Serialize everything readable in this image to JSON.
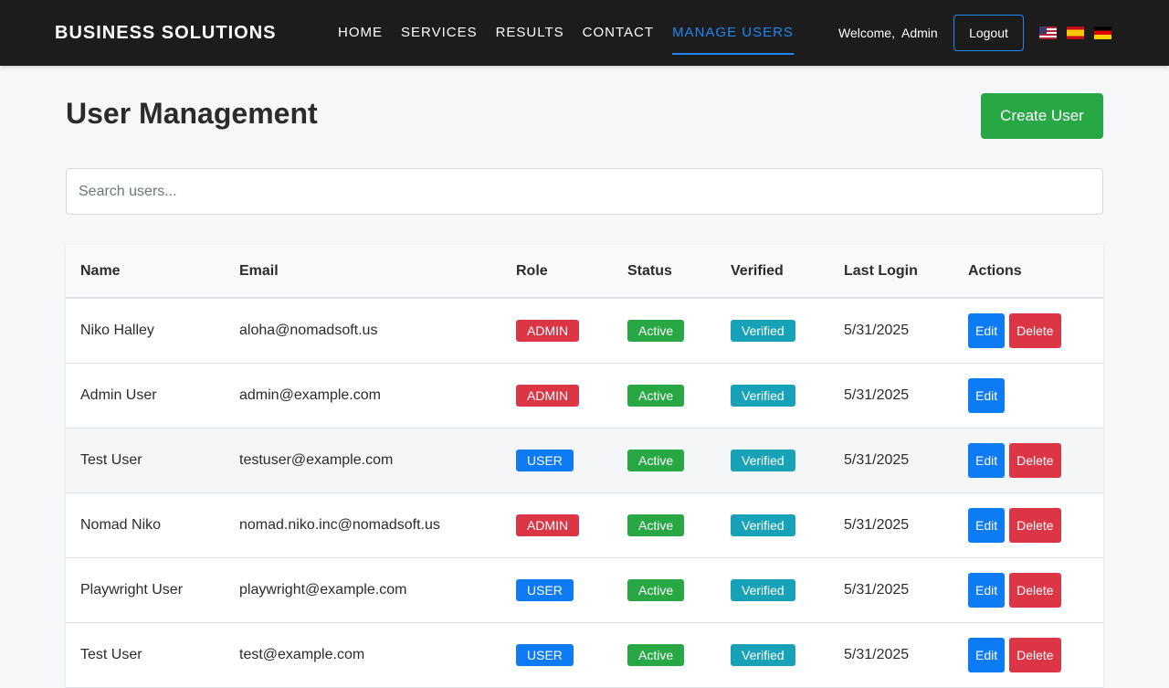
{
  "navbar": {
    "brand": "BUSINESS SOLUTIONS",
    "links": [
      "HOME",
      "SERVICES",
      "RESULTS",
      "CONTACT",
      "MANAGE USERS"
    ],
    "active_link": "MANAGE USERS",
    "welcome_label": "Welcome,",
    "username": "Admin",
    "logout_label": "Logout",
    "languages": [
      "flag-us-icon",
      "flag-es-icon",
      "flag-de-icon"
    ]
  },
  "page": {
    "title": "User Management",
    "create_label": "Create User"
  },
  "search": {
    "placeholder": "Search users...",
    "value": ""
  },
  "table": {
    "columns": [
      "Name",
      "Email",
      "Role",
      "Status",
      "Verified",
      "Last Login",
      "Actions"
    ],
    "edit_label": "Edit",
    "delete_label": "Delete",
    "rows": [
      {
        "name": "Niko Halley",
        "email": "aloha@nomadsoft.us",
        "role": "ADMIN",
        "status": "Active",
        "verified": "Verified",
        "last_login": "5/31/2025",
        "deletable": true
      },
      {
        "name": "Admin User",
        "email": "admin@example.com",
        "role": "ADMIN",
        "status": "Active",
        "verified": "Verified",
        "last_login": "5/31/2025",
        "deletable": false
      },
      {
        "name": "Test User",
        "email": "testuser@example.com",
        "role": "USER",
        "status": "Active",
        "verified": "Verified",
        "last_login": "5/31/2025",
        "deletable": true
      },
      {
        "name": "Nomad Niko",
        "email": "nomad.niko.inc@nomadsoft.us",
        "role": "ADMIN",
        "status": "Active",
        "verified": "Verified",
        "last_login": "5/31/2025",
        "deletable": true
      },
      {
        "name": "Playwright User",
        "email": "playwright@example.com",
        "role": "USER",
        "status": "Active",
        "verified": "Verified",
        "last_login": "5/31/2025",
        "deletable": true
      },
      {
        "name": "Test User",
        "email": "test@example.com",
        "role": "USER",
        "status": "Active",
        "verified": "Verified",
        "last_login": "5/31/2025",
        "deletable": true
      }
    ]
  },
  "colors": {
    "navbar_bg": "#1c1c1c",
    "accent": "#1e88f5",
    "success": "#28a745",
    "danger": "#dc3545",
    "info": "#17a2b8",
    "primary": "#0d7bf4"
  }
}
